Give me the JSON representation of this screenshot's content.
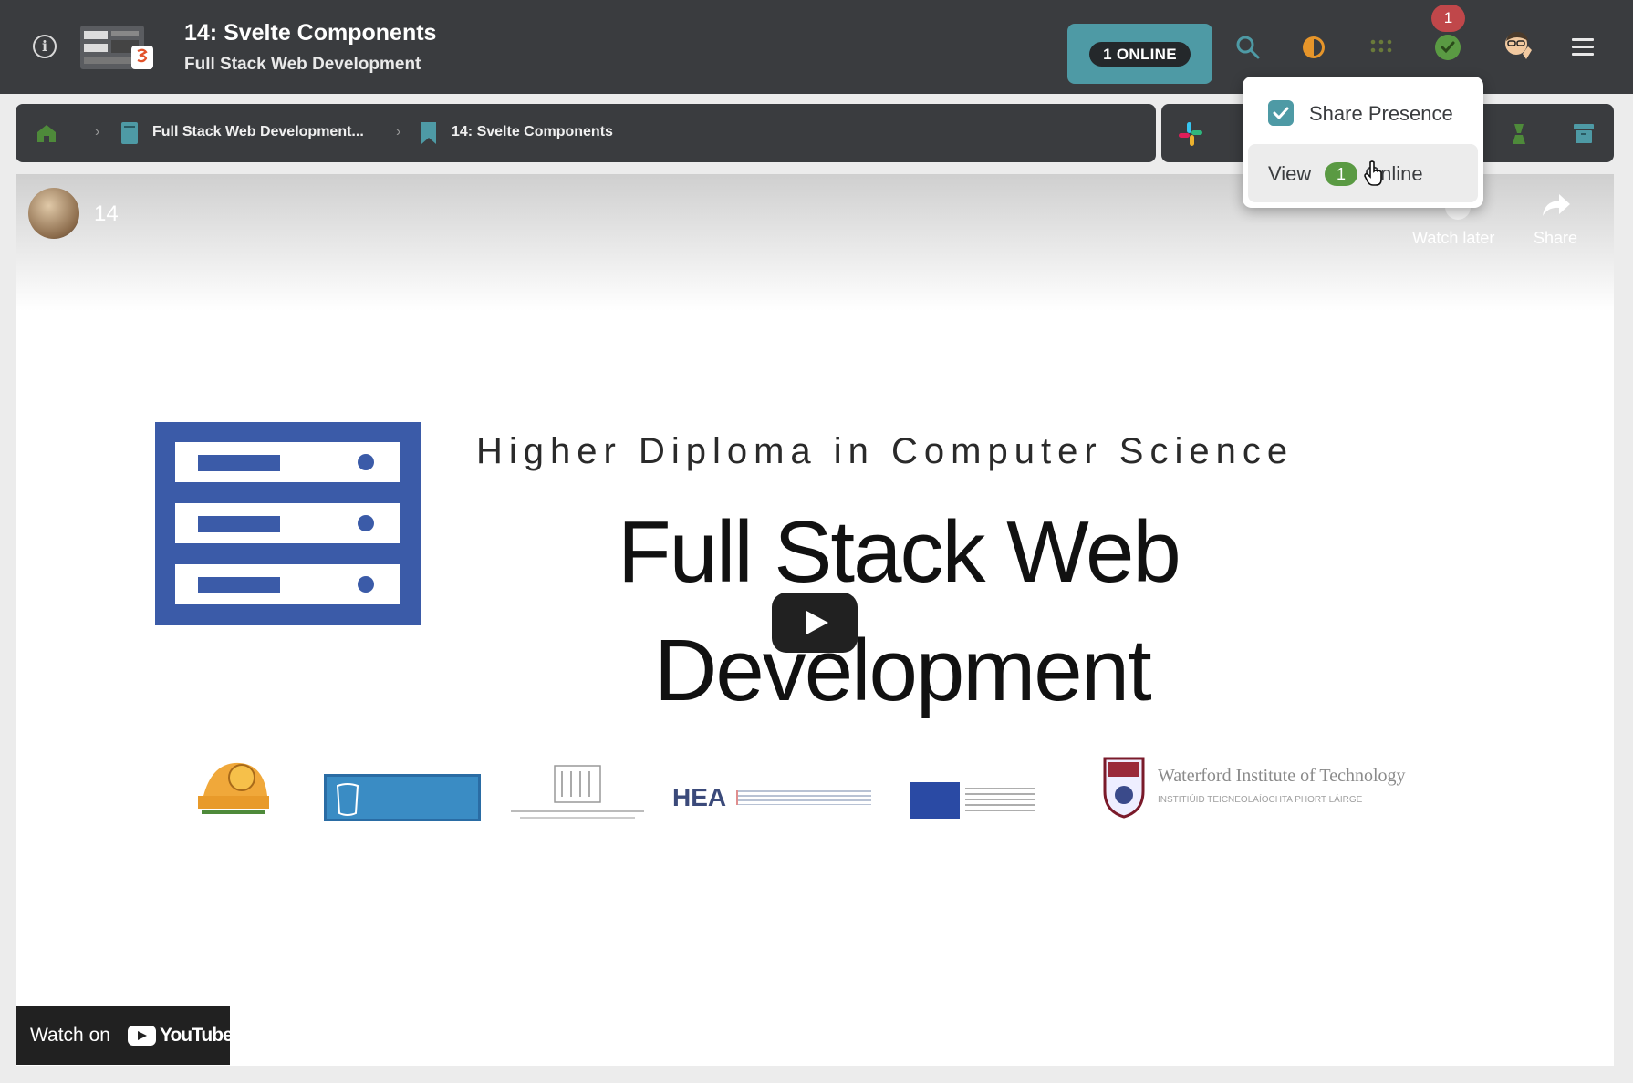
{
  "header": {
    "title": "14: Svelte Components",
    "subtitle": "Full Stack Web Development",
    "online_label": "1 ONLINE",
    "notification_count": "1",
    "icons": [
      "info-icon",
      "course-logo",
      "search-icon",
      "theme-toggle-icon",
      "apps-grid-icon",
      "presence-check-icon",
      "user-avatar",
      "menu-icon"
    ],
    "colors": {
      "bar": "#3a3c3f",
      "accent": "#4e9aa5",
      "badge": "#c0474a",
      "success": "#5a9a43"
    }
  },
  "breadcrumb": {
    "items": [
      {
        "label": "Full Stack Web Development...",
        "icon": "book-icon"
      },
      {
        "label": "14: Svelte Components",
        "icon": "bookmark-icon"
      }
    ],
    "home_icon": "home-icon"
  },
  "toolbar": {
    "icons": [
      "slack-icon",
      "tutors-icon",
      "archive-icon"
    ]
  },
  "presence_menu": {
    "share_label": "Share Presence",
    "share_checked": true,
    "view_prefix": "View",
    "view_count": "1",
    "view_suffix": "Online"
  },
  "video": {
    "title": "14",
    "watch_later_label": "Watch later",
    "share_label": "Share",
    "slide": {
      "heading": "Higher Diploma in Computer Science",
      "title_line1": "Full Stack Web",
      "title_line2": "Development"
    },
    "sponsors": {
      "hea": "HEA",
      "wit": "Waterford Institute of Technology",
      "wit_sub": "INSTITIÚID TEICNEOLAÍOCHTA PHORT LÁIRGE"
    },
    "youtube": {
      "watch_on": "Watch on",
      "brand": "YouTube"
    }
  }
}
